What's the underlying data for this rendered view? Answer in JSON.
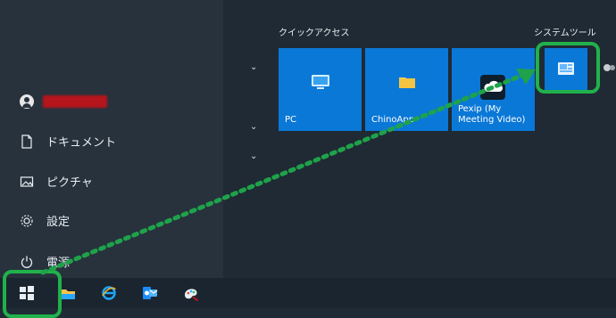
{
  "start_menu": {
    "group_quick": "クイックアクセス",
    "group_system": "システムツール",
    "left_items": [
      {
        "label": "ドキュメント"
      },
      {
        "label": "ピクチャ"
      },
      {
        "label": "設定"
      },
      {
        "label": "電源"
      }
    ],
    "tiles": [
      {
        "label": "PC"
      },
      {
        "label": "ChinoApp"
      },
      {
        "label_line1": "Pexip (My",
        "label_line2": "Meeting Video)"
      }
    ]
  },
  "taskbar": {
    "icons": [
      "windows-start-icon",
      "file-explorer-icon",
      "internet-explorer-icon",
      "outlook-icon",
      "paint-icon"
    ]
  },
  "annotation_colors": {
    "highlight": "#21b14b",
    "dotted_arrow": "#1fa24a"
  }
}
